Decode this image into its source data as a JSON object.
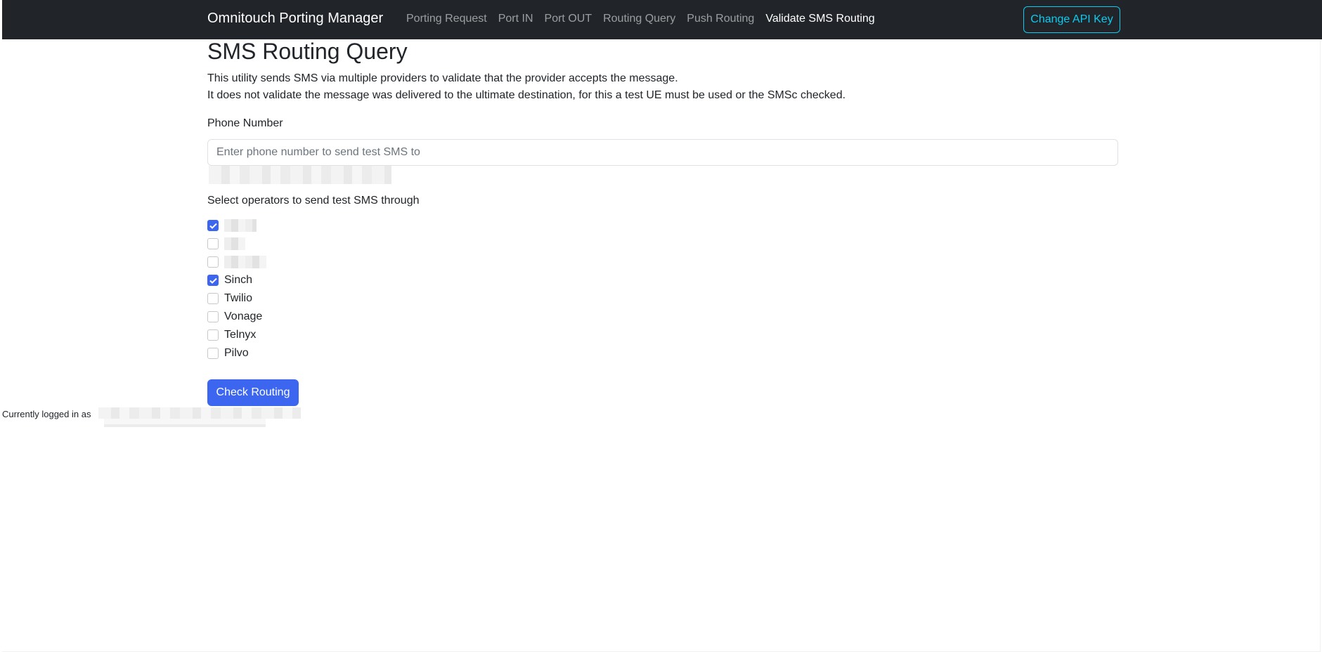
{
  "navbar": {
    "brand": "Omnitouch Porting Manager",
    "links": [
      {
        "label": "Porting Request",
        "active": false
      },
      {
        "label": "Port IN",
        "active": false
      },
      {
        "label": "Port OUT",
        "active": false
      },
      {
        "label": "Routing Query",
        "active": false
      },
      {
        "label": "Push Routing",
        "active": false
      },
      {
        "label": "Validate SMS Routing",
        "active": true
      }
    ],
    "api_key_button": "Change API Key"
  },
  "main": {
    "title": "SMS Routing Query",
    "description_line1": "This utility sends SMS via multiple providers to validate that the provider accepts the message.",
    "description_line2": "It does not validate the message was delivered to the ultimate destination, for this a test UE must be used or the SMSc checked.",
    "phone_label": "Phone Number",
    "phone_value": "",
    "phone_placeholder": "Enter phone number to send test SMS to",
    "operators_label": "Select operators to send test SMS through",
    "operators": [
      {
        "label": "",
        "checked": true,
        "redacted": true
      },
      {
        "label": "",
        "checked": false,
        "redacted": true
      },
      {
        "label": "",
        "checked": false,
        "redacted": true
      },
      {
        "label": "Sinch",
        "checked": true,
        "redacted": false
      },
      {
        "label": "Twilio",
        "checked": false,
        "redacted": false
      },
      {
        "label": "Vonage",
        "checked": false,
        "redacted": false
      },
      {
        "label": "Telnyx",
        "checked": false,
        "redacted": false
      },
      {
        "label": "Pilvo",
        "checked": false,
        "redacted": false
      }
    ],
    "submit_button": "Check Routing"
  },
  "footer": {
    "logged_in_text": "Currently logged in as"
  },
  "colors": {
    "navbar_bg": "#212529",
    "primary": "#3c66f0",
    "info": "#0dcaf0"
  }
}
